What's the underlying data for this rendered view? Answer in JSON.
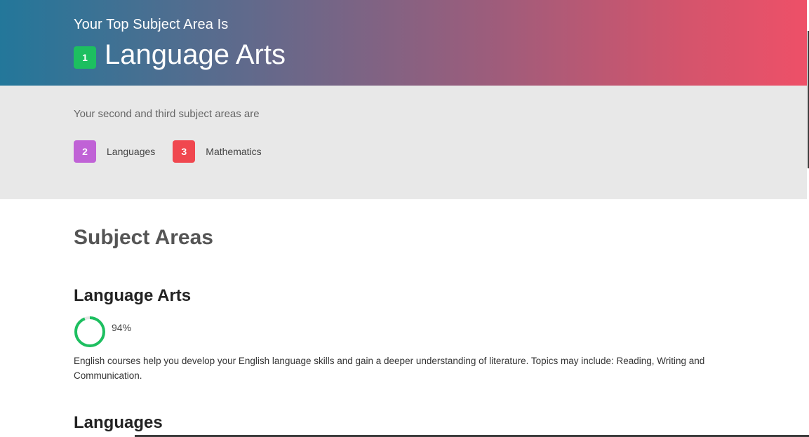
{
  "hero": {
    "kicker": "Your Top Subject Area Is",
    "rank": "1",
    "title": "Language Arts",
    "rank_color": "#1dbf60"
  },
  "secondary": {
    "label": "Your second and third subject areas are",
    "items": [
      {
        "rank": "2",
        "label": "Languages",
        "color": "#c062d6"
      },
      {
        "rank": "3",
        "label": "Mathematics",
        "color": "#f0474f"
      }
    ]
  },
  "main": {
    "heading": "Subject Areas",
    "subjects": [
      {
        "title": "Language Arts",
        "percent_label": "94%",
        "percent": 94,
        "ring_color": "#1dbf60",
        "description": "English courses help you develop your English language skills and gain a deeper understanding of literature. Topics may include: Reading, Writing and Communication."
      },
      {
        "title": "Languages"
      }
    ]
  }
}
